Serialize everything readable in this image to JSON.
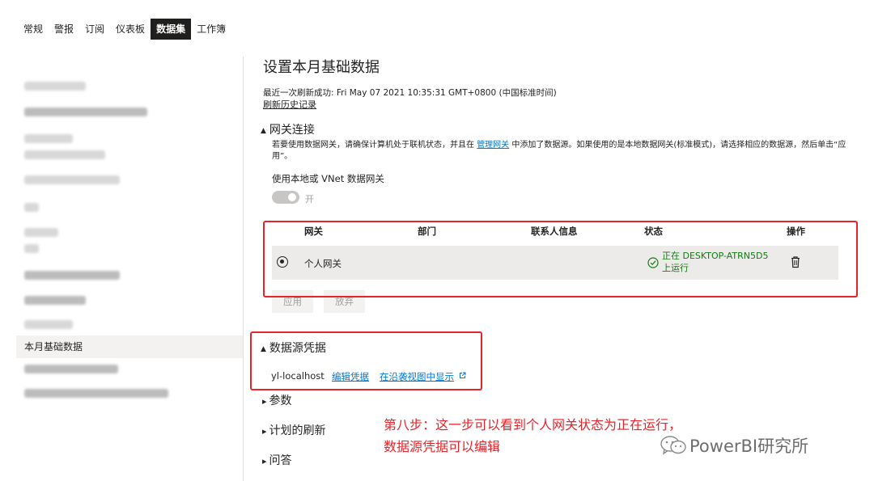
{
  "tabs": [
    "常规",
    "警报",
    "订阅",
    "仪表板",
    "数据集",
    "工作簿"
  ],
  "active_tab": "数据集",
  "sidebar": {
    "selected_item": "本月基础数据"
  },
  "main": {
    "title": "设置本月基础数据",
    "last_refresh": "最近一次刷新成功: Fri May 07 2021 10:35:31 GMT+0800 (中国标准时间)",
    "refresh_history_link": "刷新历史记录",
    "gateway_section": {
      "heading": "网关连接",
      "desc_part1": "若要使用数据网关，请确保计算机处于联机状态，并且在 ",
      "desc_link": "管理网关",
      "desc_part2": " 中添加了数据源。如果使用的是本地数据网关(标准模式)，请选择相应的数据源，然后单击“应用”。",
      "vnet_label": "使用本地或 VNet 数据网关",
      "toggle_label": "开",
      "toggle_on": true,
      "columns": [
        "网关",
        "部门",
        "联系人信息",
        "状态",
        "操作"
      ],
      "row": {
        "name": "个人网关",
        "status_line1": "正在 DESKTOP-ATRN5D5",
        "status_line2": "上运行"
      },
      "apply_button": "应用",
      "discard_button": "放弃"
    },
    "credentials_section": {
      "heading": "数据源凭据",
      "host": "yl-localhost",
      "edit_link": "编辑凭据",
      "lineage_link": "在沿袭视图中显示"
    },
    "parameters_heading": "参数",
    "scheduled_refresh_heading": "计划的刷新",
    "qa_heading": "问答"
  },
  "annotation": {
    "line1": "第八步：这一步可以看到个人网关状态为正在运行，",
    "line2": "数据源凭据可以编辑"
  },
  "watermark": "PowerBI研究所",
  "colors": {
    "annotation_red": "#e8232a",
    "link_blue": "#0078d4",
    "status_green": "#107c10",
    "active_tab_bg": "#201f1e"
  }
}
